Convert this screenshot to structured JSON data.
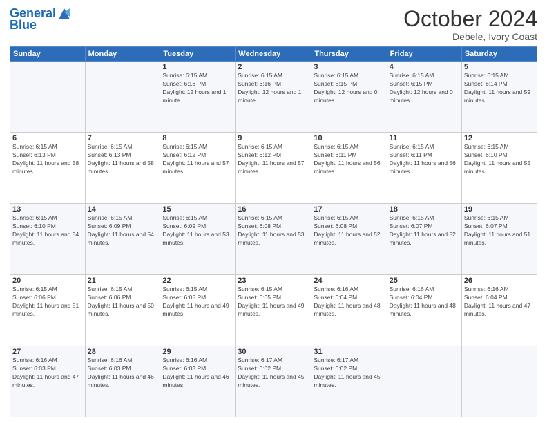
{
  "logo": {
    "line1": "General",
    "line2": "Blue"
  },
  "header": {
    "title": "October 2024",
    "subtitle": "Debele, Ivory Coast"
  },
  "days_of_week": [
    "Sunday",
    "Monday",
    "Tuesday",
    "Wednesday",
    "Thursday",
    "Friday",
    "Saturday"
  ],
  "weeks": [
    [
      {
        "day": "",
        "sunrise": "",
        "sunset": "",
        "daylight": ""
      },
      {
        "day": "",
        "sunrise": "",
        "sunset": "",
        "daylight": ""
      },
      {
        "day": "1",
        "sunrise": "Sunrise: 6:15 AM",
        "sunset": "Sunset: 6:16 PM",
        "daylight": "Daylight: 12 hours and 1 minute."
      },
      {
        "day": "2",
        "sunrise": "Sunrise: 6:15 AM",
        "sunset": "Sunset: 6:16 PM",
        "daylight": "Daylight: 12 hours and 1 minute."
      },
      {
        "day": "3",
        "sunrise": "Sunrise: 6:15 AM",
        "sunset": "Sunset: 6:15 PM",
        "daylight": "Daylight: 12 hours and 0 minutes."
      },
      {
        "day": "4",
        "sunrise": "Sunrise: 6:15 AM",
        "sunset": "Sunset: 6:15 PM",
        "daylight": "Daylight: 12 hours and 0 minutes."
      },
      {
        "day": "5",
        "sunrise": "Sunrise: 6:15 AM",
        "sunset": "Sunset: 6:14 PM",
        "daylight": "Daylight: 11 hours and 59 minutes."
      }
    ],
    [
      {
        "day": "6",
        "sunrise": "Sunrise: 6:15 AM",
        "sunset": "Sunset: 6:13 PM",
        "daylight": "Daylight: 11 hours and 58 minutes."
      },
      {
        "day": "7",
        "sunrise": "Sunrise: 6:15 AM",
        "sunset": "Sunset: 6:13 PM",
        "daylight": "Daylight: 11 hours and 58 minutes."
      },
      {
        "day": "8",
        "sunrise": "Sunrise: 6:15 AM",
        "sunset": "Sunset: 6:12 PM",
        "daylight": "Daylight: 11 hours and 57 minutes."
      },
      {
        "day": "9",
        "sunrise": "Sunrise: 6:15 AM",
        "sunset": "Sunset: 6:12 PM",
        "daylight": "Daylight: 11 hours and 57 minutes."
      },
      {
        "day": "10",
        "sunrise": "Sunrise: 6:15 AM",
        "sunset": "Sunset: 6:11 PM",
        "daylight": "Daylight: 11 hours and 56 minutes."
      },
      {
        "day": "11",
        "sunrise": "Sunrise: 6:15 AM",
        "sunset": "Sunset: 6:11 PM",
        "daylight": "Daylight: 11 hours and 56 minutes."
      },
      {
        "day": "12",
        "sunrise": "Sunrise: 6:15 AM",
        "sunset": "Sunset: 6:10 PM",
        "daylight": "Daylight: 11 hours and 55 minutes."
      }
    ],
    [
      {
        "day": "13",
        "sunrise": "Sunrise: 6:15 AM",
        "sunset": "Sunset: 6:10 PM",
        "daylight": "Daylight: 11 hours and 54 minutes."
      },
      {
        "day": "14",
        "sunrise": "Sunrise: 6:15 AM",
        "sunset": "Sunset: 6:09 PM",
        "daylight": "Daylight: 11 hours and 54 minutes."
      },
      {
        "day": "15",
        "sunrise": "Sunrise: 6:15 AM",
        "sunset": "Sunset: 6:09 PM",
        "daylight": "Daylight: 11 hours and 53 minutes."
      },
      {
        "day": "16",
        "sunrise": "Sunrise: 6:15 AM",
        "sunset": "Sunset: 6:08 PM",
        "daylight": "Daylight: 11 hours and 53 minutes."
      },
      {
        "day": "17",
        "sunrise": "Sunrise: 6:15 AM",
        "sunset": "Sunset: 6:08 PM",
        "daylight": "Daylight: 11 hours and 52 minutes."
      },
      {
        "day": "18",
        "sunrise": "Sunrise: 6:15 AM",
        "sunset": "Sunset: 6:07 PM",
        "daylight": "Daylight: 11 hours and 52 minutes."
      },
      {
        "day": "19",
        "sunrise": "Sunrise: 6:15 AM",
        "sunset": "Sunset: 6:07 PM",
        "daylight": "Daylight: 11 hours and 51 minutes."
      }
    ],
    [
      {
        "day": "20",
        "sunrise": "Sunrise: 6:15 AM",
        "sunset": "Sunset: 6:06 PM",
        "daylight": "Daylight: 11 hours and 51 minutes."
      },
      {
        "day": "21",
        "sunrise": "Sunrise: 6:15 AM",
        "sunset": "Sunset: 6:06 PM",
        "daylight": "Daylight: 11 hours and 50 minutes."
      },
      {
        "day": "22",
        "sunrise": "Sunrise: 6:15 AM",
        "sunset": "Sunset: 6:05 PM",
        "daylight": "Daylight: 11 hours and 49 minutes."
      },
      {
        "day": "23",
        "sunrise": "Sunrise: 6:15 AM",
        "sunset": "Sunset: 6:05 PM",
        "daylight": "Daylight: 11 hours and 49 minutes."
      },
      {
        "day": "24",
        "sunrise": "Sunrise: 6:16 AM",
        "sunset": "Sunset: 6:04 PM",
        "daylight": "Daylight: 11 hours and 48 minutes."
      },
      {
        "day": "25",
        "sunrise": "Sunrise: 6:16 AM",
        "sunset": "Sunset: 6:04 PM",
        "daylight": "Daylight: 11 hours and 48 minutes."
      },
      {
        "day": "26",
        "sunrise": "Sunrise: 6:16 AM",
        "sunset": "Sunset: 6:04 PM",
        "daylight": "Daylight: 11 hours and 47 minutes."
      }
    ],
    [
      {
        "day": "27",
        "sunrise": "Sunrise: 6:16 AM",
        "sunset": "Sunset: 6:03 PM",
        "daylight": "Daylight: 11 hours and 47 minutes."
      },
      {
        "day": "28",
        "sunrise": "Sunrise: 6:16 AM",
        "sunset": "Sunset: 6:03 PM",
        "daylight": "Daylight: 11 hours and 46 minutes."
      },
      {
        "day": "29",
        "sunrise": "Sunrise: 6:16 AM",
        "sunset": "Sunset: 6:03 PM",
        "daylight": "Daylight: 11 hours and 46 minutes."
      },
      {
        "day": "30",
        "sunrise": "Sunrise: 6:17 AM",
        "sunset": "Sunset: 6:02 PM",
        "daylight": "Daylight: 11 hours and 45 minutes."
      },
      {
        "day": "31",
        "sunrise": "Sunrise: 6:17 AM",
        "sunset": "Sunset: 6:02 PM",
        "daylight": "Daylight: 11 hours and 45 minutes."
      },
      {
        "day": "",
        "sunrise": "",
        "sunset": "",
        "daylight": ""
      },
      {
        "day": "",
        "sunrise": "",
        "sunset": "",
        "daylight": ""
      }
    ]
  ]
}
